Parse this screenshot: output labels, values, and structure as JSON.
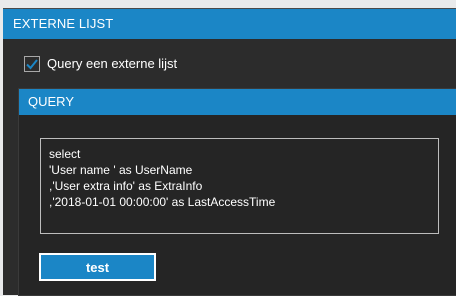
{
  "panel": {
    "title": "EXTERNE LIJST",
    "checkbox": {
      "label": "Query een externe lijst",
      "checked": true
    },
    "query_section": {
      "title": "QUERY",
      "lines": [
        "select",
        "'User name ' as UserName",
        ",'User extra info' as ExtraInfo",
        ",'2018-01-01 00:00:00' as LastAccessTime"
      ],
      "test_button_label": "test"
    }
  },
  "colors": {
    "accent": "#1b86c6",
    "panel_bg": "#2c2c2c",
    "inner_bg": "#252525",
    "text": "#ffffff"
  },
  "icons": {
    "checkbox": "checkmark-icon"
  }
}
